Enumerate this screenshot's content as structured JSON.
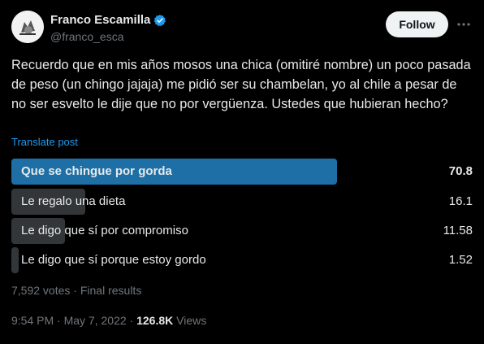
{
  "author": {
    "display_name": "Franco Escamilla",
    "handle": "@franco_esca",
    "verified": true
  },
  "header": {
    "follow_label": "Follow",
    "more_icon": "more-horizontal-icon"
  },
  "post": {
    "text": "Recuerdo que en mis años mosos una chica (omitiré nombre) un poco pasada de peso (un chingo jajaja) me pidió ser su chambelan, yo al chile a pesar de no ser esvelto le dije que no por vergüenza. Ustedes que hubieran hecho?",
    "translate_label": "Translate post"
  },
  "poll": {
    "options": [
      {
        "label": "Que se chingue por gorda",
        "percent": "70.8",
        "value": 70.8,
        "winner": true
      },
      {
        "label": "Le regalo una dieta",
        "percent": "16.1",
        "value": 16.1,
        "winner": false
      },
      {
        "label": "Le digo que sí por compromiso",
        "percent": "11.58",
        "value": 11.58,
        "winner": false
      },
      {
        "label": "Le digo que sí porque estoy gordo",
        "percent": "1.52",
        "value": 1.52,
        "winner": false
      }
    ],
    "votes": "7,592 votes",
    "separator": "·",
    "status": "Final results"
  },
  "meta": {
    "time": "9:54 PM",
    "separator": "·",
    "date": "May 7, 2022",
    "views_count": "126.8K",
    "views_label": "Views"
  },
  "colors": {
    "background": "#000000",
    "text": "#e7e9ea",
    "secondary_text": "#71767b",
    "link": "#1d9bf0",
    "winner_bar": "#1d6fa5",
    "loser_bar": "#333639",
    "verified_badge": "#1d9bf0"
  }
}
